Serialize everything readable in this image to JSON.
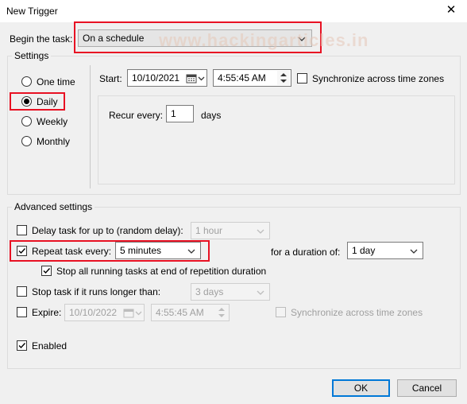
{
  "window": {
    "title": "New Trigger",
    "close_glyph": "✕"
  },
  "watermark": "www.hackingarticles.in",
  "begin": {
    "label": "Begin the task:",
    "value": "On a schedule"
  },
  "settings": {
    "title": "Settings",
    "radios": [
      {
        "label": "One time",
        "selected": false
      },
      {
        "label": "Daily",
        "selected": true
      },
      {
        "label": "Weekly",
        "selected": false
      },
      {
        "label": "Monthly",
        "selected": false
      }
    ],
    "start_label": "Start:",
    "start_date": "10/10/2021",
    "start_time": "4:55:45 AM",
    "sync_label": "Synchronize across time zones",
    "recur_label": "Recur every:",
    "recur_value": "1",
    "recur_unit": "days"
  },
  "advanced": {
    "title": "Advanced settings",
    "delay": {
      "label": "Delay task for up to (random delay):",
      "checked": false,
      "value": "1 hour"
    },
    "repeat": {
      "label": "Repeat task every:",
      "checked": true,
      "value": "5 minutes",
      "duration_label": "for a duration of:",
      "duration_value": "1 day"
    },
    "stop_running": {
      "label": "Stop all running tasks at end of repetition duration",
      "checked": true
    },
    "stop_longer": {
      "label": "Stop task if it runs longer than:",
      "checked": false,
      "value": "3 days"
    },
    "expire": {
      "label": "Expire:",
      "checked": false,
      "date": "10/10/2022",
      "time": "4:55:45 AM",
      "sync_label": "Synchronize across time zones"
    },
    "enabled": {
      "label": "Enabled",
      "checked": true
    }
  },
  "buttons": {
    "ok": "OK",
    "cancel": "Cancel"
  },
  "colors": {
    "highlight_red": "#e81123",
    "default_button_blue": "#0078d7"
  }
}
